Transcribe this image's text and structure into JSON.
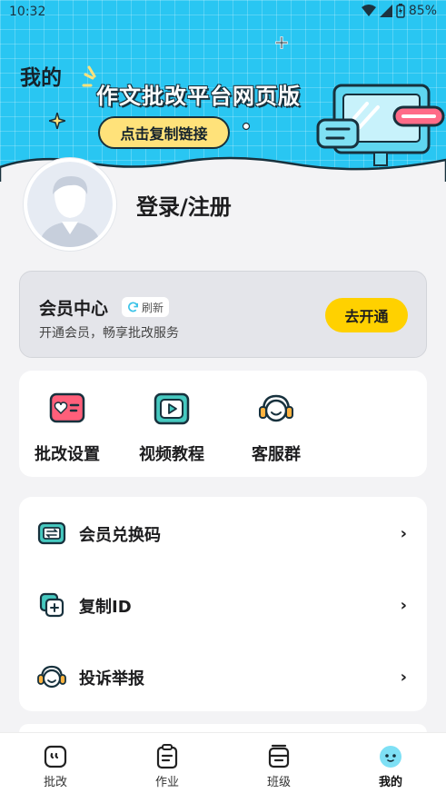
{
  "status_bar": {
    "time": "10:32",
    "battery": "85%"
  },
  "header": {
    "title": "我的",
    "banner_title": "作文批改平台网页版",
    "copy_link_button": "点击复制链接"
  },
  "profile": {
    "login_text": "登录/注册"
  },
  "member_card": {
    "title": "会员中心",
    "refresh_label": "刷新",
    "subtitle": "开通会员，畅享批改服务",
    "open_button": "去开通"
  },
  "features": [
    {
      "label": "批改设置",
      "icon": "heart-card-icon"
    },
    {
      "label": "视频教程",
      "icon": "video-play-icon"
    },
    {
      "label": "客服群",
      "icon": "headset-icon"
    }
  ],
  "menu": [
    {
      "label": "会员兑换码",
      "icon": "exchange-card-icon"
    },
    {
      "label": "复制ID",
      "icon": "copy-icon"
    },
    {
      "label": "投诉举报",
      "icon": "headset-icon"
    }
  ],
  "tabs": [
    {
      "label": "批改",
      "icon": "quote-icon"
    },
    {
      "label": "作业",
      "icon": "clipboard-icon"
    },
    {
      "label": "班级",
      "icon": "class-box-icon"
    },
    {
      "label": "我的",
      "icon": "face-icon",
      "active": true
    }
  ],
  "colors": {
    "header_blue": "#29c6f2",
    "accent_yellow": "#ffd100",
    "icon_teal": "#46c9c0",
    "icon_pink": "#ff5f7a"
  }
}
